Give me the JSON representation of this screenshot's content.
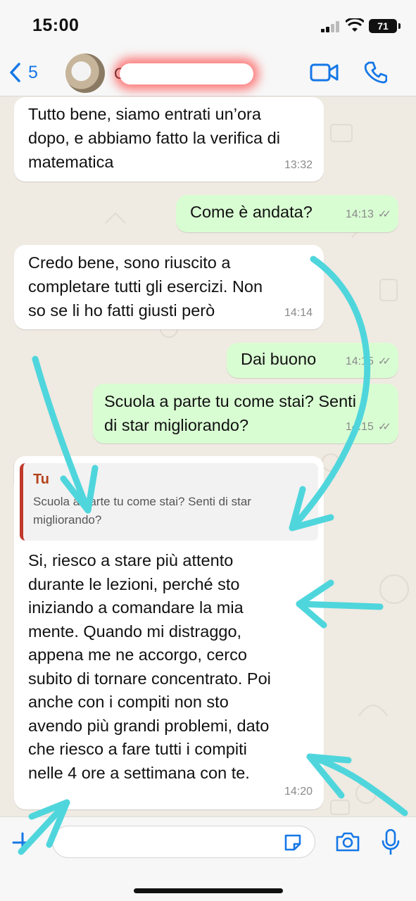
{
  "status_bar": {
    "time": "15:00",
    "battery": "71"
  },
  "header": {
    "back_count": "5",
    "contact_initial": "C"
  },
  "messages": [
    {
      "text_lines": [
        "Tutto bene, siamo entrati un’ora",
        "dopo, e abbiamo fatto la verifica di",
        "matematica"
      ],
      "time": "13:32"
    },
    {
      "text": "Come è andata?",
      "time": "14:13"
    },
    {
      "text_lines": [
        "Credo bene, sono riuscito a",
        "completare tutti gli esercizi. Non",
        "so se li ho fatti giusti però"
      ],
      "time": "14:14"
    },
    {
      "text": "Dai buono",
      "time": "14:15"
    },
    {
      "text_lines": [
        "Scuola a parte tu come stai? Senti",
        "di star migliorando?"
      ],
      "time": "14:15"
    },
    {
      "quote_author": "Tu",
      "quote_lines": [
        "Scuola a parte tu come stai? Senti di star",
        "migliorando?"
      ],
      "text_lines": [
        "Si, riesco a stare più attento",
        "durante le lezioni, perché sto",
        "iniziando a comandare la mia",
        "mente. Quando mi distraggo,",
        "appena me ne accorgo, cerco",
        "subito di tornare concentrato. Poi",
        "anche con i compiti non sto",
        "avendo più grandi problemi, dato",
        "che riesco a fare tutti i compiti",
        "nelle 4 ore a settimana con te."
      ],
      "time": "14:20"
    }
  ],
  "input": {
    "placeholder": ""
  },
  "colors": {
    "accent": "#1577e6",
    "outgoing_bubble": "#d9fdd3",
    "annotation": "#4fd6dc",
    "quote_bar": "#c0392b"
  },
  "icons": [
    "chevron-left-icon",
    "video-icon",
    "phone-icon",
    "plus-icon",
    "sticker-icon",
    "camera-icon",
    "mic-icon",
    "read-receipt-icon"
  ]
}
